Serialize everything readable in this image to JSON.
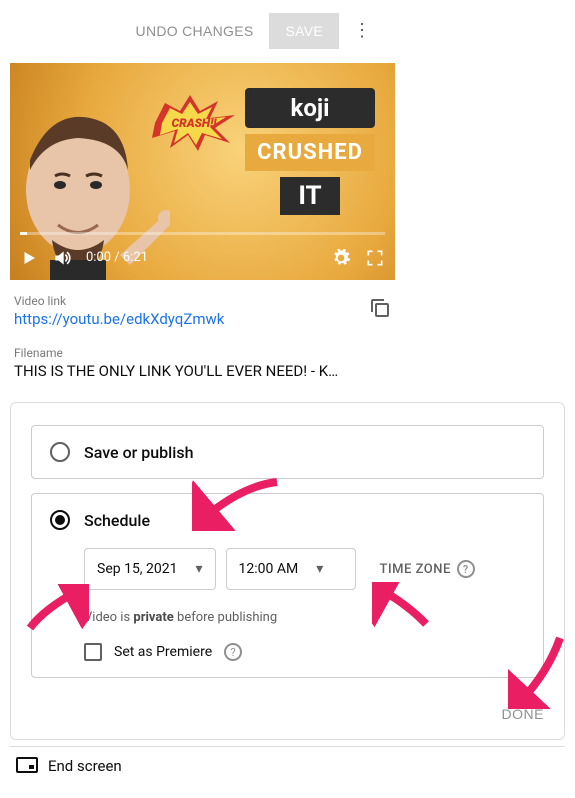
{
  "toolbar": {
    "undo_label": "UNDO CHANGES",
    "save_label": "SAVE"
  },
  "video": {
    "time_text": "0:00 / 6:21",
    "thumb": {
      "koji": "koji",
      "crushed": "CRUSHED",
      "it": "IT",
      "crash": "CRASH!!"
    }
  },
  "meta": {
    "link_label": "Video link",
    "link_url": "https://youtu.be/edkXdyqZmwk",
    "filename_label": "Filename",
    "filename_text": "THIS IS THE ONLY LINK YOU'LL EVER NEED! - K…"
  },
  "publish": {
    "save_option": "Save or publish",
    "schedule_label": "Schedule",
    "date_value": "Sep 15, 2021",
    "time_value": "12:00 AM",
    "timezone_label": "TIME ZONE",
    "private_note_before": "Video is ",
    "private_note_bold": "private",
    "private_note_after": " before publishing",
    "premiere_label": "Set as Premiere",
    "done_label": "DONE"
  },
  "end_screen": {
    "label": "End screen"
  }
}
